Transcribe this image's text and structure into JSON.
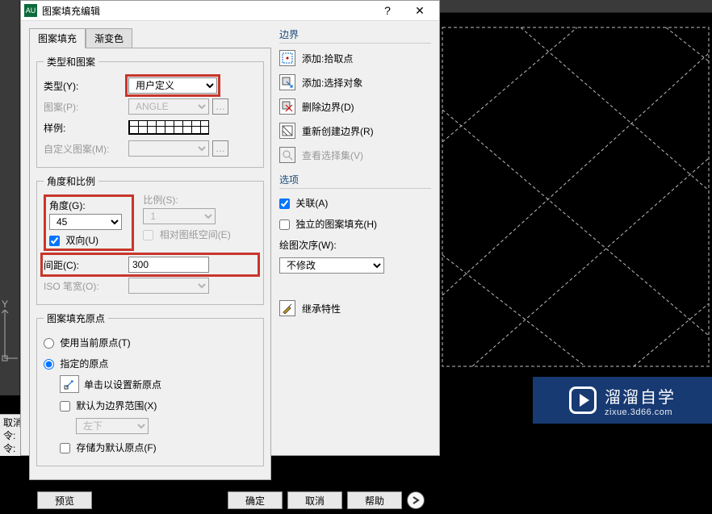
{
  "titlebar": {
    "icon": "AU",
    "title": "图案填充编辑"
  },
  "tabs": {
    "active": "图案填充",
    "other": "渐变色"
  },
  "groups": {
    "type_pattern": {
      "legend": "类型和图案",
      "type_label": "类型(Y):",
      "type_value": "用户定义",
      "pattern_label": "图案(P):",
      "pattern_value": "ANGLE",
      "sample_label": "样例:",
      "custom_label": "自定义图案(M):"
    },
    "angle_scale": {
      "legend": "角度和比例",
      "angle_label": "角度(G):",
      "angle_value": "45",
      "scale_label": "比例(S):",
      "scale_value": "1",
      "bidir_label": "双向(U)",
      "paperspace_label": "相对图纸空间(E)",
      "spacing_label": "间距(C):",
      "spacing_value": "300",
      "iso_label": "ISO 笔宽(O):"
    },
    "origin": {
      "legend": "图案填充原点",
      "use_current": "使用当前原点(T)",
      "specify": "指定的原点",
      "click_new": "单击以设置新原点",
      "default_extents": "默认为边界范围(X)",
      "extents_value": "左下",
      "store_default": "存储为默认原点(F)"
    }
  },
  "boundary": {
    "title": "边界",
    "pick": "添加:拾取点",
    "select": "添加:选择对象",
    "remove": "删除边界(D)",
    "recreate": "重新创建边界(R)",
    "view": "查看选择集(V)"
  },
  "options": {
    "title": "选项",
    "assoc": "关联(A)",
    "indep": "独立的图案填充(H)",
    "draworder_label": "绘图次序(W):",
    "draworder_value": "不修改"
  },
  "inherit": {
    "label": "继承特性"
  },
  "footer": {
    "preview": "预览",
    "ok": "确定",
    "cancel": "取消",
    "help": "帮助"
  },
  "cmd": {
    "line1": "取消",
    "line2": "令:",
    "line3": "令:"
  },
  "watermark": {
    "cn": "溜溜自学",
    "url": "zixue.3d66.com"
  }
}
